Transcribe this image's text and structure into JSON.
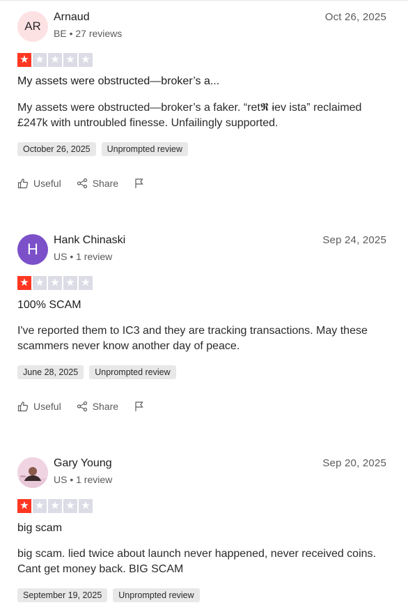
{
  "reviews": [
    {
      "author": "Arnaud",
      "initials": "AR",
      "meta": "BE • 27 reviews",
      "date": "Oct 26, 2025",
      "rating": 1,
      "title": "My assets were obstructed—broker’s a...",
      "body": "My assets were obstructed—broker’s a faker. “ret𝕽 ɨev ista” reclaimed £247k with untroubled finesse. Unfailingly supported.",
      "experience_date": "October 26, 2025",
      "tag": "Unprompted review",
      "useful_label": "Useful",
      "share_label": "Share"
    },
    {
      "author": "Hank Chinaski",
      "initials": "H",
      "meta": "US • 1 review",
      "date": "Sep 24, 2025",
      "rating": 1,
      "title": "100% SCAM",
      "body": "I've reported them to IC3 and they are tracking transactions. May these scammers never know another day of peace.",
      "experience_date": "June 28, 2025",
      "tag": "Unprompted review",
      "useful_label": "Useful",
      "share_label": "Share"
    },
    {
      "author": "Gary Young",
      "initials": "",
      "meta": "US • 1 review",
      "date": "Sep 20, 2025",
      "rating": 1,
      "title": "big scam",
      "body": "big scam. lied twice about launch never happened, never received coins. Cant get money back. BIG SCAM",
      "experience_date": "September 19, 2025",
      "tag": "Unprompted review"
    }
  ],
  "colors": {
    "star_on": "#ff3722",
    "star_off": "#dcdce6",
    "avatar_purple": "#7b50c9",
    "avatar_pink": "#fde2e4"
  },
  "icons": {
    "useful": "thumbs-up-icon",
    "share": "share-icon",
    "report": "flag-icon",
    "star": "star-icon"
  }
}
